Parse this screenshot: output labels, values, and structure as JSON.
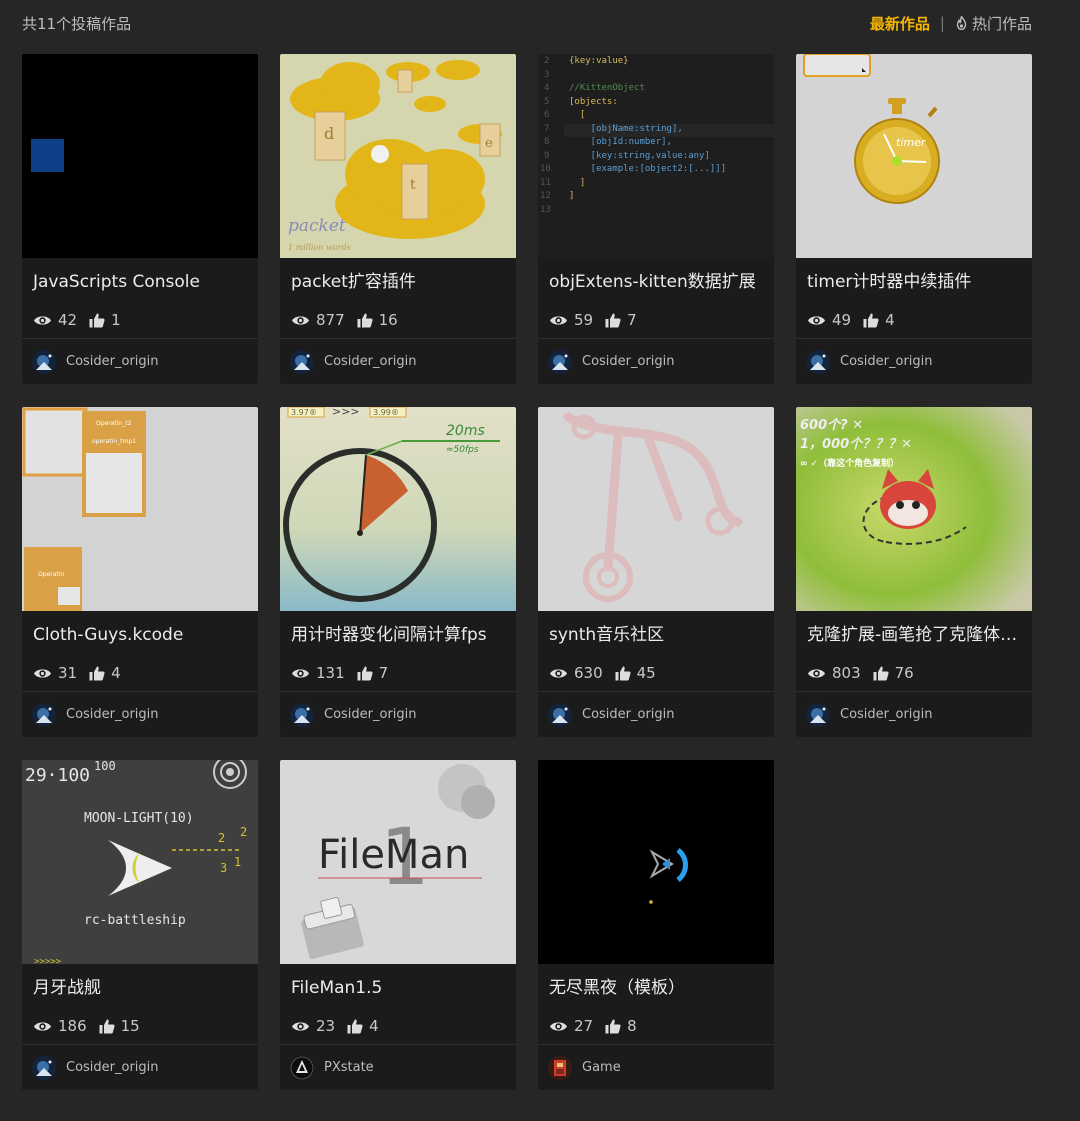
{
  "header": {
    "count_label": "共11个投稿作品",
    "sort_latest": "最新作品",
    "sort_separator": "|",
    "sort_hot": "热门作品"
  },
  "works": [
    {
      "title": "JavaScripts Console",
      "views": "42",
      "likes": "1",
      "author": "Cosider_origin"
    },
    {
      "title": "packet扩容插件",
      "views": "877",
      "likes": "16",
      "author": "Cosider_origin"
    },
    {
      "title": "objExtens-kitten数据扩展",
      "views": "59",
      "likes": "7",
      "author": "Cosider_origin"
    },
    {
      "title": "timer计时器中续插件",
      "views": "49",
      "likes": "4",
      "author": "Cosider_origin"
    },
    {
      "title": "Cloth-Guys.kcode",
      "views": "31",
      "likes": "4",
      "author": "Cosider_origin"
    },
    {
      "title": "用计时器变化间隔计算fps",
      "views": "131",
      "likes": "7",
      "author": "Cosider_origin"
    },
    {
      "title": "synth音乐社区",
      "views": "630",
      "likes": "45",
      "author": "Cosider_origin"
    },
    {
      "title": "克隆扩展-画笔抢了克隆体的饭碗",
      "views": "803",
      "likes": "76",
      "author": "Cosider_origin"
    },
    {
      "title": "月牙战舰",
      "views": "186",
      "likes": "15",
      "author": "Cosider_origin"
    },
    {
      "title": "FileMan1.5",
      "views": "23",
      "likes": "4",
      "author": "PXstate"
    },
    {
      "title": "无尽黑夜（模板）",
      "views": "27",
      "likes": "8",
      "author": "Game"
    }
  ],
  "thumb_text": {
    "packet_word": "packet",
    "packet_sub": "1 million words",
    "code_lines": [
      "{key:value}",
      "",
      "//KittenObject",
      "[objects:",
      "  [",
      "    [objName:string],",
      "    [objId:number],",
      "    [key:string,value:any]",
      "    [example:[object2:[...]]]",
      "  ]",
      "]",
      ""
    ],
    "code_line_numbers": [
      "2",
      "3",
      "4",
      "5",
      "6",
      "7",
      "8",
      "9",
      "10",
      "11",
      "12",
      "13"
    ],
    "timer_word": "timer",
    "cloth_label_1": "Operatin_t2",
    "cloth_label_2": "operatin_tmp1",
    "cloth_label_3": "Operatin",
    "fps_ms": "20ms",
    "fps_fps": "≈50fps",
    "fps_top_1": "3.97®",
    "fps_top_arrows": ">>>",
    "fps_top_2": "3.99®",
    "clone_line_1": "600个? ✕",
    "clone_line_2": "1，000个？？？✕",
    "clone_line_3": "∞ ✓（靠这个角色复制）",
    "moon_score": "29·100",
    "moon_hi": "100",
    "moon_title": "MOON-LIGHT(10)",
    "moon_sub": "rc-battleship",
    "moon_arrows": ">>>>>",
    "moon_n1": "2",
    "moon_n2": "2",
    "moon_n3": "3",
    "moon_n4": "1",
    "fileman_word": "FileMan",
    "fileman_num": "1"
  },
  "colors": {
    "accent": "#f5b400",
    "card_bg": "#1b1b1b",
    "page_bg": "#262626"
  },
  "icons": {
    "views": "eye-icon",
    "likes": "thumbs-up-icon",
    "hot": "flame-icon"
  }
}
